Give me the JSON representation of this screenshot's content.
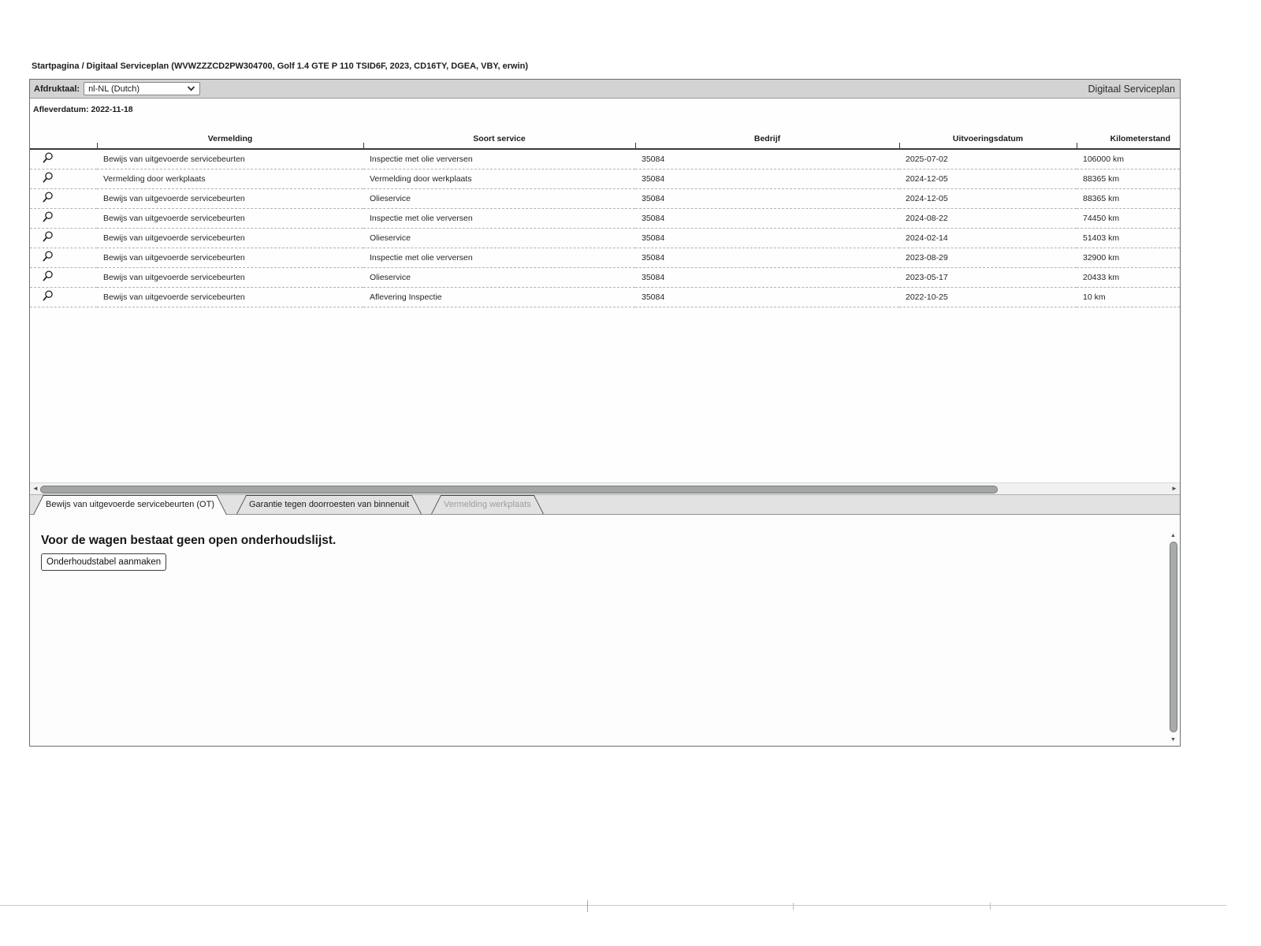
{
  "breadcrumb": "Startpagina / Digitaal Serviceplan (WVWZZZCD2PW304700, Golf 1.4 GTE P 110 TSID6F, 2023, CD16TY, DGEA, VBY, erwin)",
  "header": {
    "app_title": "Digitaal Serviceplan",
    "print_language_label": "Afdruktaal:",
    "print_language_value": "nl-NL (Dutch)",
    "delivery_date": "Afleverdatum: 2022-11-18"
  },
  "table": {
    "columns": [
      "Vermelding",
      "Soort service",
      "Bedrijf",
      "Uitvoeringsdatum",
      "Kilometerstand"
    ],
    "rows": [
      {
        "vermelding": "Bewijs van uitgevoerde servicebeurten",
        "soort_service": "Inspectie met olie verversen",
        "bedrijf": "35084",
        "uitvoeringsdatum": "2025-07-02",
        "kilometerstand": "106000 km"
      },
      {
        "vermelding": "Vermelding door werkplaats",
        "soort_service": "Vermelding door werkplaats",
        "bedrijf": "35084",
        "uitvoeringsdatum": "2024-12-05",
        "kilometerstand": "88365 km"
      },
      {
        "vermelding": "Bewijs van uitgevoerde servicebeurten",
        "soort_service": "Olieservice",
        "bedrijf": "35084",
        "uitvoeringsdatum": "2024-12-05",
        "kilometerstand": "88365 km"
      },
      {
        "vermelding": "Bewijs van uitgevoerde servicebeurten",
        "soort_service": "Inspectie met olie verversen",
        "bedrijf": "35084",
        "uitvoeringsdatum": "2024-08-22",
        "kilometerstand": "74450 km"
      },
      {
        "vermelding": "Bewijs van uitgevoerde servicebeurten",
        "soort_service": "Olieservice",
        "bedrijf": "35084",
        "uitvoeringsdatum": "2024-02-14",
        "kilometerstand": "51403 km"
      },
      {
        "vermelding": "Bewijs van uitgevoerde servicebeurten",
        "soort_service": "Inspectie met olie verversen",
        "bedrijf": "35084",
        "uitvoeringsdatum": "2023-08-29",
        "kilometerstand": "32900 km"
      },
      {
        "vermelding": "Bewijs van uitgevoerde servicebeurten",
        "soort_service": "Olieservice",
        "bedrijf": "35084",
        "uitvoeringsdatum": "2023-05-17",
        "kilometerstand": "20433 km"
      },
      {
        "vermelding": "Bewijs van uitgevoerde servicebeurten",
        "soort_service": "Aflevering Inspectie",
        "bedrijf": "35084",
        "uitvoeringsdatum": "2022-10-25",
        "kilometerstand": "10 km"
      }
    ]
  },
  "tabs": [
    {
      "id": "service-history",
      "label": "Bewijs van uitgevoerde servicebeurten (OT)",
      "active": true,
      "disabled": false
    },
    {
      "id": "rust-warranty",
      "label": "Garantie tegen doorroesten van binnenuit",
      "active": false,
      "disabled": false
    },
    {
      "id": "workshop-note",
      "label": "Vermelding werkplaats",
      "active": false,
      "disabled": true
    }
  ],
  "bottom_panel": {
    "message": "Voor de wagen bestaat geen open onderhoudslijst.",
    "button_label": "Onderhoudstabel aanmaken"
  },
  "icons": {
    "row_action": "magnifier-icon",
    "language_dropdown": "chevron-down-icon",
    "h_scroll_left": "◄",
    "h_scroll_right": "►",
    "v_scroll_up": "▲",
    "v_scroll_down": "▼"
  },
  "colors": {
    "titlebar_bg": "#d3d3d3",
    "tab_bar_bg": "#e2e2e2",
    "active_tab_bg": "#fcfcfc",
    "text": "#222222"
  }
}
